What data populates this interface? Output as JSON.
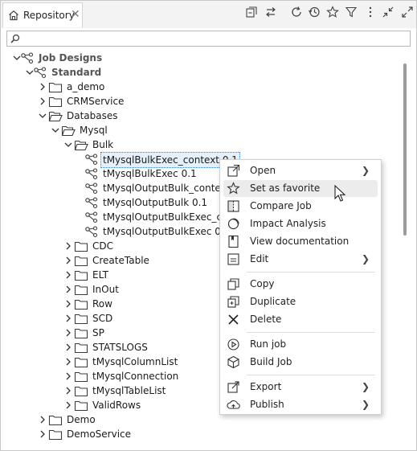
{
  "window": {
    "tab_label": "Repository",
    "tab_close": "✕"
  },
  "toolbar": [
    "collapse-all-icon",
    "sync-icon",
    "refresh-icon",
    "history-icon",
    "favorite-star-icon",
    "filter-icon",
    "more-vertical-icon",
    "minimize-icon",
    "maximize-icon"
  ],
  "search": {
    "value": "",
    "placeholder": ""
  },
  "tree": [
    {
      "label": "Job Designs",
      "level": 0,
      "icon": "job-designs",
      "expanded": true,
      "bold": true
    },
    {
      "label": "Standard",
      "level": 1,
      "icon": "job-designs",
      "expanded": true,
      "bold": true
    },
    {
      "label": "a_demo",
      "level": 2,
      "icon": "folder",
      "expanded": false
    },
    {
      "label": "CRMService",
      "level": 2,
      "icon": "folder",
      "expanded": false
    },
    {
      "label": "Databases",
      "level": 2,
      "icon": "folder-open",
      "expanded": true
    },
    {
      "label": "Mysql",
      "level": 3,
      "icon": "folder-open",
      "expanded": true
    },
    {
      "label": "Bulk",
      "level": 4,
      "icon": "folder-open",
      "expanded": true
    },
    {
      "label": "tMysqlBulkExec_context 0.1",
      "level": 5,
      "icon": "job",
      "selected": true
    },
    {
      "label": "tMysqlBulkExec 0.1",
      "level": 5,
      "icon": "job"
    },
    {
      "label": "tMysqlOutputBulk_context",
      "level": 5,
      "icon": "job"
    },
    {
      "label": "tMysqlOutputBulk 0.1",
      "level": 5,
      "icon": "job"
    },
    {
      "label": "tMysqlOutputBulkExec_con",
      "level": 5,
      "icon": "job"
    },
    {
      "label": "tMysqlOutputBulkExec 0.1",
      "level": 5,
      "icon": "job"
    },
    {
      "label": "CDC",
      "level": 4,
      "icon": "folder",
      "expanded": false
    },
    {
      "label": "CreateTable",
      "level": 4,
      "icon": "folder",
      "expanded": false
    },
    {
      "label": "ELT",
      "level": 4,
      "icon": "folder",
      "expanded": false
    },
    {
      "label": "InOut",
      "level": 4,
      "icon": "folder",
      "expanded": false
    },
    {
      "label": "Row",
      "level": 4,
      "icon": "folder",
      "expanded": false
    },
    {
      "label": "SCD",
      "level": 4,
      "icon": "folder",
      "expanded": false
    },
    {
      "label": "SP",
      "level": 4,
      "icon": "folder",
      "expanded": false
    },
    {
      "label": "STATSLOGS",
      "level": 4,
      "icon": "folder",
      "expanded": false
    },
    {
      "label": "tMysqlColumnList",
      "level": 4,
      "icon": "folder",
      "expanded": false
    },
    {
      "label": "tMysqlConnection",
      "level": 4,
      "icon": "folder",
      "expanded": false
    },
    {
      "label": "tMysqlTableList",
      "level": 4,
      "icon": "folder",
      "expanded": false
    },
    {
      "label": "ValidRows",
      "level": 4,
      "icon": "folder",
      "expanded": false
    },
    {
      "label": "Demo",
      "level": 2,
      "icon": "folder",
      "expanded": false
    },
    {
      "label": "DemoService",
      "level": 2,
      "icon": "folder",
      "expanded": false
    }
  ],
  "context_menu": [
    {
      "label": "Open",
      "icon": "open-external-icon",
      "submenu": true
    },
    {
      "label": "Set as favorite",
      "icon": "star-icon",
      "hover": true
    },
    {
      "label": "Compare Job",
      "icon": "compare-icon"
    },
    {
      "label": "Impact Analysis",
      "icon": "impact-analysis-icon"
    },
    {
      "label": "View documentation",
      "icon": "documentation-icon"
    },
    {
      "label": "Edit",
      "icon": "edit-icon",
      "submenu": true
    },
    {
      "separator": true
    },
    {
      "label": "Copy",
      "icon": "copy-icon"
    },
    {
      "label": "Duplicate",
      "icon": "duplicate-icon"
    },
    {
      "label": "Delete",
      "icon": "delete-icon"
    },
    {
      "separator": true
    },
    {
      "label": "Run job",
      "icon": "run-icon"
    },
    {
      "label": "Build Job",
      "icon": "build-icon"
    },
    {
      "separator": true
    },
    {
      "label": "Export",
      "icon": "export-icon",
      "submenu": true
    },
    {
      "label": "Publish",
      "icon": "publish-icon",
      "submenu": true
    }
  ],
  "colors": {
    "selection_bg": "#e5f0fb",
    "selection_border": "#3c7fd0",
    "hover_bg": "#ececec",
    "icon": "#3a3a3a"
  }
}
